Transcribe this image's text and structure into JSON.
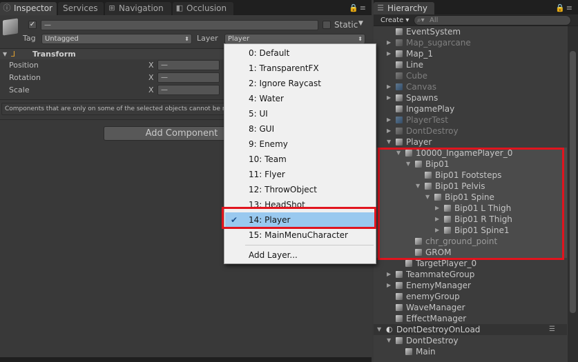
{
  "inspector": {
    "tabs": [
      {
        "label": "Inspector",
        "icon": "info-icon"
      },
      {
        "label": "Services",
        "icon": "cloud-icon"
      },
      {
        "label": "Navigation",
        "icon": "navigation-icon"
      },
      {
        "label": "Occlusion",
        "icon": "occlusion-icon"
      }
    ],
    "name_value": "—",
    "static_label": "Static",
    "tag_label": "Tag",
    "tag_value": "Untagged",
    "layer_label": "Layer",
    "layer_value": "Player",
    "transform_label": "Transform",
    "position_label": "Position",
    "rotation_label": "Rotation",
    "scale_label": "Scale",
    "axis_x": "X",
    "mixed_value": "—",
    "note_text": "Components that are only on some of the selected objects cannot be multi-edited.",
    "add_component_label": "Add Component"
  },
  "layer_menu": {
    "items": [
      "0: Default",
      "1: TransparentFX",
      "2: Ignore Raycast",
      "4: Water",
      "5: UI",
      "8: GUI",
      "9: Enemy",
      "10: Team",
      "11: Flyer",
      "12: ThrowObject",
      "13: HeadShot",
      "14: Player",
      "15: MainMenuCharacter"
    ],
    "selected": "14: Player",
    "add_layer_label": "Add Layer..."
  },
  "hierarchy": {
    "tab_label": "Hierarchy",
    "create_label": "Create ▾",
    "search_placeholder": "All",
    "rows": [
      "EventSystem",
      "Map_sugarcane",
      "Map_1",
      "Line",
      "Cube",
      "Canvas",
      "Spawns",
      "IngamePlay",
      "PlayerTest",
      "DontDestroy",
      "Player",
      "10000_IngamePlayer_0",
      "Bip01",
      "Bip01 Footsteps",
      "Bip01 Pelvis",
      "Bip01 Spine",
      "Bip01 L Thigh",
      "Bip01 R Thigh",
      "Bip01 Spine1",
      "chr_ground_point",
      "GROM",
      "TargetPlayer_0",
      "TeammateGroup",
      "EnemyManager",
      "enemyGroup",
      "WaveManager",
      "EffectManager"
    ],
    "scene_name": "DontDestroyOnLoad",
    "scene_rows": [
      "DontDestroy",
      "Main"
    ]
  },
  "colors": {
    "selection_blue": "#99c9ef",
    "highlight_red": "#e1141e",
    "panel_bg": "#393939"
  }
}
